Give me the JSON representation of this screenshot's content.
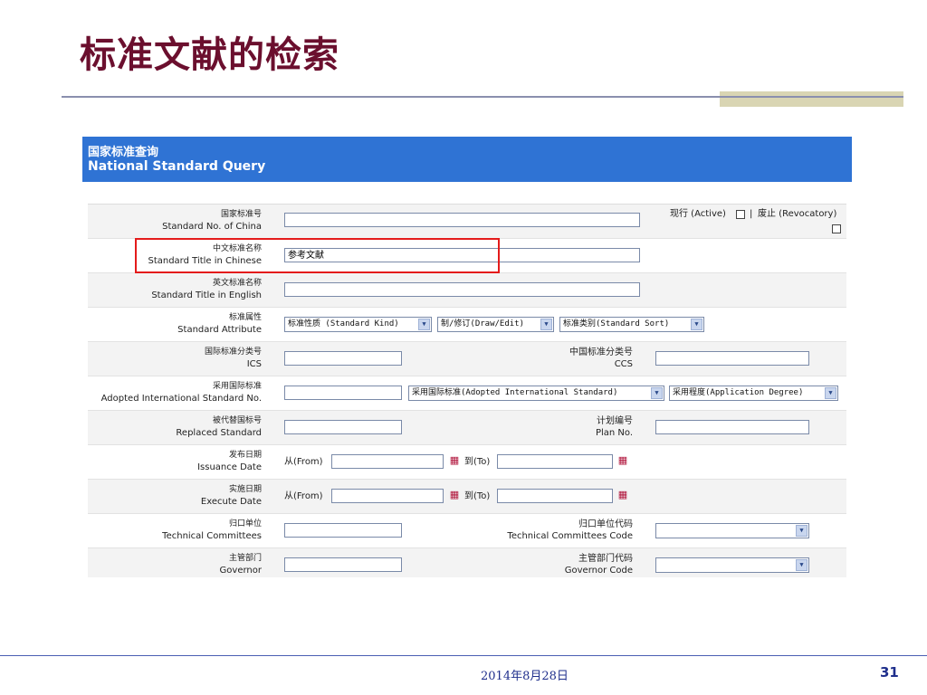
{
  "slide": {
    "title": "标准文献的检索",
    "footer_date": "2014年8月28日",
    "page_number": "31"
  },
  "screenshot": {
    "header_cn": "国家标准查询",
    "header_en": "National Standard Query",
    "rows": {
      "std_no": {
        "cn": "国家标准号",
        "en": "Standard No. of China",
        "value": ""
      },
      "status": {
        "active": "现行 (Active)",
        "separator": "|",
        "revocatory": "废止 (Revocatory)"
      },
      "title_cn": {
        "cn": "中文标准名称",
        "en": "Standard Title in Chinese",
        "value": "参考文献"
      },
      "title_en": {
        "cn": "英文标准名称",
        "en": "Standard Title in English",
        "value": ""
      },
      "attr": {
        "cn": "标准属性",
        "en": "Standard Attribute",
        "kind": "标准性质 (Standard Kind)",
        "draw": "制/修订(Draw/Edit)",
        "sort": "标准类别(Standard Sort)"
      },
      "ics": {
        "cn": "国际标准分类号",
        "en": "ICS"
      },
      "ccs": {
        "cn": "中国标准分类号",
        "en": "CCS"
      },
      "adopted": {
        "cn": "采用国际标准",
        "en": "Adopted International Standard No.",
        "standard": "采用国际标准(Adopted International Standard)",
        "degree": "采用程度(Application Degree)"
      },
      "replaced": {
        "cn": "被代替国标号",
        "en": "Replaced Standard"
      },
      "plan": {
        "cn": "计划编号",
        "en": "Plan No."
      },
      "issuance": {
        "cn": "发布日期",
        "en": "Issuance Date",
        "from": "从(From)",
        "to": "到(To)"
      },
      "execute": {
        "cn": "实施日期",
        "en": "Execute Date",
        "from": "从(From)",
        "to": "到(To)"
      },
      "tc": {
        "cn": "归口单位",
        "en": "Technical Committees"
      },
      "tc_code": {
        "cn": "归口单位代码",
        "en": "Technical Committees Code"
      },
      "gov": {
        "cn": "主管部门",
        "en": "Governor"
      },
      "gov_code": {
        "cn": "主管部门代码",
        "en": "Governor Code"
      }
    }
  },
  "colors": {
    "title": "#6b0f2e",
    "header_bg": "#2f73d4",
    "highlight": "#e41b1b",
    "footer": "#1f2f8c"
  }
}
